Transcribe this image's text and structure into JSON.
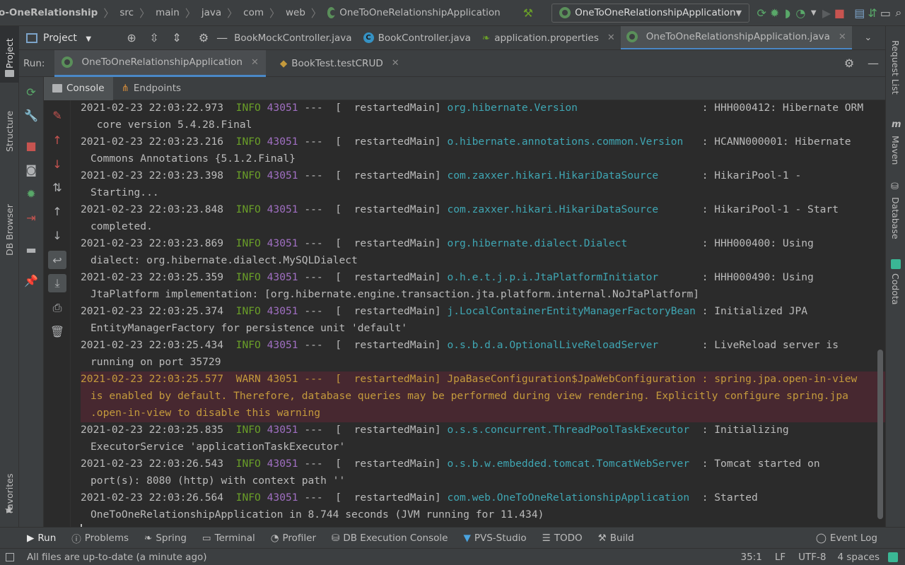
{
  "navbar": {
    "crumbs": [
      "o-OneRelationship",
      "src",
      "main",
      "java",
      "com",
      "web",
      "OneToOneRelationshipApplication"
    ],
    "run_config": "OneToOneRelationshipApplication"
  },
  "editor_tabs": {
    "project_label": "Project",
    "tabs": [
      {
        "label": "BookMockController.java"
      },
      {
        "label": "BookController.java"
      },
      {
        "label": "application.properties"
      },
      {
        "label": "OneToOneRelationshipApplication.java"
      }
    ]
  },
  "run": {
    "label": "Run:",
    "tabs": [
      "OneToOneRelationshipApplication",
      "BookTest.testCRUD"
    ],
    "subtabs": [
      "Console",
      "Endpoints"
    ]
  },
  "console": {
    "lines": [
      {
        "ts": "2021-02-23 22:03:22.973",
        "lvl": "INFO",
        "pid": "43051",
        "thr": "---  [  restartedMain]",
        "cls": "org.hibernate.Version",
        "msg": ": HHH000412: Hibernate ORM",
        "cont": " core version 5.4.28.Final"
      },
      {
        "ts": "2021-02-23 22:03:23.216",
        "lvl": "INFO",
        "pid": "43051",
        "thr": "---  [  restartedMain]",
        "cls": "o.hibernate.annotations.common.Version",
        "msg": ": HCANN000001: Hibernate",
        "cont": "Commons Annotations {5.1.2.Final}"
      },
      {
        "ts": "2021-02-23 22:03:23.398",
        "lvl": "INFO",
        "pid": "43051",
        "thr": "---  [  restartedMain]",
        "cls": "com.zaxxer.hikari.HikariDataSource",
        "msg": ": HikariPool-1 -",
        "cont": "Starting..."
      },
      {
        "ts": "2021-02-23 22:03:23.848",
        "lvl": "INFO",
        "pid": "43051",
        "thr": "---  [  restartedMain]",
        "cls": "com.zaxxer.hikari.HikariDataSource",
        "msg": ": HikariPool-1 - Start",
        "cont": "completed."
      },
      {
        "ts": "2021-02-23 22:03:23.869",
        "lvl": "INFO",
        "pid": "43051",
        "thr": "---  [  restartedMain]",
        "cls": "org.hibernate.dialect.Dialect",
        "msg": ": HHH000400: Using",
        "cont": "dialect: org.hibernate.dialect.MySQLDialect"
      },
      {
        "ts": "2021-02-23 22:03:25.359",
        "lvl": "INFO",
        "pid": "43051",
        "thr": "---  [  restartedMain]",
        "cls": "o.h.e.t.j.p.i.JtaPlatformInitiator",
        "msg": ": HHH000490: Using",
        "cont": "JtaPlatform implementation: [org.hibernate.engine.transaction.jta.platform.internal.NoJtaPlatform]"
      },
      {
        "ts": "2021-02-23 22:03:25.374",
        "lvl": "INFO",
        "pid": "43051",
        "thr": "---  [  restartedMain]",
        "cls": "j.LocalContainerEntityManagerFactoryBean",
        "msg": ": Initialized JPA",
        "cont": "EntityManagerFactory for persistence unit 'default'"
      },
      {
        "ts": "2021-02-23 22:03:25.434",
        "lvl": "INFO",
        "pid": "43051",
        "thr": "---  [  restartedMain]",
        "cls": "o.s.b.d.a.OptionalLiveReloadServer",
        "msg": ": LiveReload server is",
        "cont": "running on port 35729"
      }
    ],
    "warn": {
      "l1": "2021-02-23 22:03:25.577  WARN 43051 ---  [  restartedMain] JpaBaseConfiguration$JpaWebConfiguration : spring.jpa.open-in-view",
      "l2": "is enabled by default. Therefore, database queries may be performed during view rendering. Explicitly configure spring.jpa",
      "l3": ".open-in-view to disable this warning"
    },
    "lines2": [
      {
        "ts": "2021-02-23 22:03:25.835",
        "lvl": "INFO",
        "pid": "43051",
        "thr": "---  [  restartedMain]",
        "cls": "o.s.s.concurrent.ThreadPoolTaskExecutor",
        "msg": ": Initializing",
        "cont": "ExecutorService 'applicationTaskExecutor'"
      },
      {
        "ts": "2021-02-23 22:03:26.543",
        "lvl": "INFO",
        "pid": "43051",
        "thr": "---  [  restartedMain]",
        "cls": "o.s.b.w.embedded.tomcat.TomcatWebServer",
        "msg": ": Tomcat started on",
        "cont": "port(s): 8080 (http) with context path ''"
      },
      {
        "ts": "2021-02-23 22:03:26.564",
        "lvl": "INFO",
        "pid": "43051",
        "thr": "---  [  restartedMain]",
        "cls": "com.web.OneToOneRelationshipApplication",
        "msg": ": Started",
        "cont": "OneToOneRelationshipApplication in 8.744 seconds (JVM running for 11.434)"
      }
    ]
  },
  "left_strip": [
    "Project",
    "Structure",
    "DB Browser",
    "Favorites"
  ],
  "right_strip": [
    "Request List",
    "Maven",
    "Database",
    "Codota"
  ],
  "tool_windows": [
    "Run",
    "Problems",
    "Spring",
    "Terminal",
    "Profiler",
    "DB Execution Console",
    "PVS-Studio",
    "TODO",
    "Build",
    "Event Log"
  ],
  "status": {
    "message": "All files are up-to-date (a minute ago)",
    "position": "35:1",
    "line_sep": "LF",
    "encoding": "UTF-8",
    "indent": "4 spaces"
  },
  "colors": {
    "info": "#6a9f28",
    "pid": "#a06fc2",
    "logger": "#3fa6b3",
    "warn_bg": "#472830",
    "warn_text": "#c49a3c"
  }
}
